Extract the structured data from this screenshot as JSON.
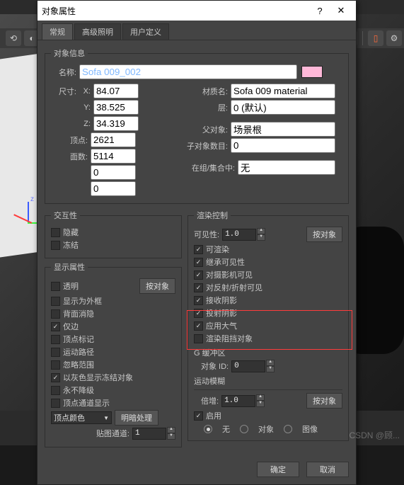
{
  "dialog_title": "对象属性",
  "tabs": [
    "常规",
    "高级照明",
    "用户定义"
  ],
  "object_info": {
    "legend": "对象信息",
    "name_label": "名称:",
    "name_value": "Sofa 009_002",
    "dim_label": "尺寸:",
    "x_label": "X:",
    "x_val": "84.07",
    "y_label": "Y:",
    "y_val": "38.525",
    "z_label": "Z:",
    "z_val": "34.319",
    "verts_label": "顶点:",
    "verts_val": "2621",
    "faces_label": "面数:",
    "faces_val": "5114",
    "mat_label": "材质名:",
    "mat_val": "Sofa 009 material",
    "layer_label": "层:",
    "layer_val": "0 (默认)",
    "parent_label": "父对象:",
    "parent_val": "场景根",
    "children_label": "子对象数目:",
    "children_val": "0",
    "group_label": "在组/集合中:",
    "group_val": "无"
  },
  "interactivity": {
    "legend": "交互性",
    "hide": "隐藏",
    "freeze": "冻结"
  },
  "display": {
    "legend": "显示属性",
    "transparent": "透明",
    "by_object": "按对象",
    "show_as_box": "显示为外框",
    "backface_cull": "背面消隐",
    "edges_only": "仅边",
    "vertex_ticks": "顶点标记",
    "motion_path": "运动路径",
    "ignore_extents": "忽略范围",
    "show_frozen_gray": "以灰色显示冻结对象",
    "never_degrade": "永不降级",
    "vertex_channel": "顶点通道显示",
    "vertex_color": "顶点颜色",
    "shaded": "明暗处理",
    "map_channel": "贴图通道:",
    "map_channel_val": "1"
  },
  "render_ctrl": {
    "legend": "渲染控制",
    "visibility": "可见性:",
    "visibility_val": "1.0",
    "by_object": "按对象",
    "renderable": "可渲染",
    "inherit_vis": "继承可见性",
    "visible_to_cam": "对摄影机可见",
    "visible_to_refl": "对反射/折射可见",
    "receive_shadows": "接收阴影",
    "cast_shadows": "投射阴影",
    "apply_atm": "应用大气",
    "render_occluded": "渲染阻挡对象"
  },
  "gbuffer": {
    "legend": "G 缓冲区",
    "obj_id": "对象 ID:",
    "obj_id_val": "0"
  },
  "motion_blur": {
    "legend": "运动模糊",
    "mult": "倍增:",
    "mult_val": "1.0",
    "by_object": "按对象",
    "enable": "启用",
    "none": "无",
    "object": "对象",
    "image": "图像"
  },
  "buttons": {
    "ok": "确定",
    "cancel": "取消"
  },
  "watermark": "CSDN @顾..."
}
